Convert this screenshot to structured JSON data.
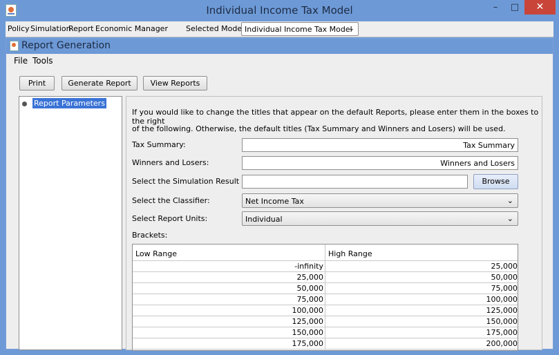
{
  "window": {
    "title": "Individual Income Tax Model",
    "minimize": "–",
    "maximize": "□",
    "close": "✕"
  },
  "main_menu": {
    "items": [
      "Policy",
      "Simulation",
      "Report",
      "Economic Manager"
    ],
    "selected_model_label": "Selected Model:",
    "selected_model_value": "Individual Income Tax Model"
  },
  "report_frame": {
    "title": "Report Generation",
    "menu": [
      "File",
      "Tools"
    ],
    "buttons": {
      "print": "Print",
      "generate": "Generate Report",
      "view": "View Reports"
    },
    "tree": {
      "item": "Report Parameters"
    }
  },
  "params": {
    "intro_line1": "If you would like to change the titles that appear on the default Reports, please enter them in the boxes to the right",
    "intro_line2": "of the following. Otherwise, the default titles (Tax Summary and Winners and Losers) will be used.",
    "tax_summary_label": "Tax Summary:",
    "tax_summary_value": "Tax Summary",
    "winners_label": "Winners and Losers:",
    "winners_value": "Winners and Losers",
    "simset_label": "Select the Simulation Result Set:",
    "simset_value": "",
    "browse": "Browse",
    "classifier_label": "Select the Classifier:",
    "classifier_value": "Net Income Tax",
    "units_label": "Select Report Units:",
    "units_value": "Individual",
    "brackets_label": "Brackets:"
  },
  "brackets": {
    "columns": [
      "Low Range",
      "High Range"
    ],
    "rows": [
      [
        "-infinity",
        "25,000"
      ],
      [
        "25,000",
        "50,000"
      ],
      [
        "50,000",
        "75,000"
      ],
      [
        "75,000",
        "100,000"
      ],
      [
        "100,000",
        "125,000"
      ],
      [
        "125,000",
        "150,000"
      ],
      [
        "150,000",
        "175,000"
      ],
      [
        "175,000",
        "200,000"
      ]
    ]
  },
  "colors": {
    "title_bar": "#6d9ad6",
    "close_button": "#c9453a",
    "selection": "#3a73d6",
    "panel_bg": "#eeeeee"
  }
}
